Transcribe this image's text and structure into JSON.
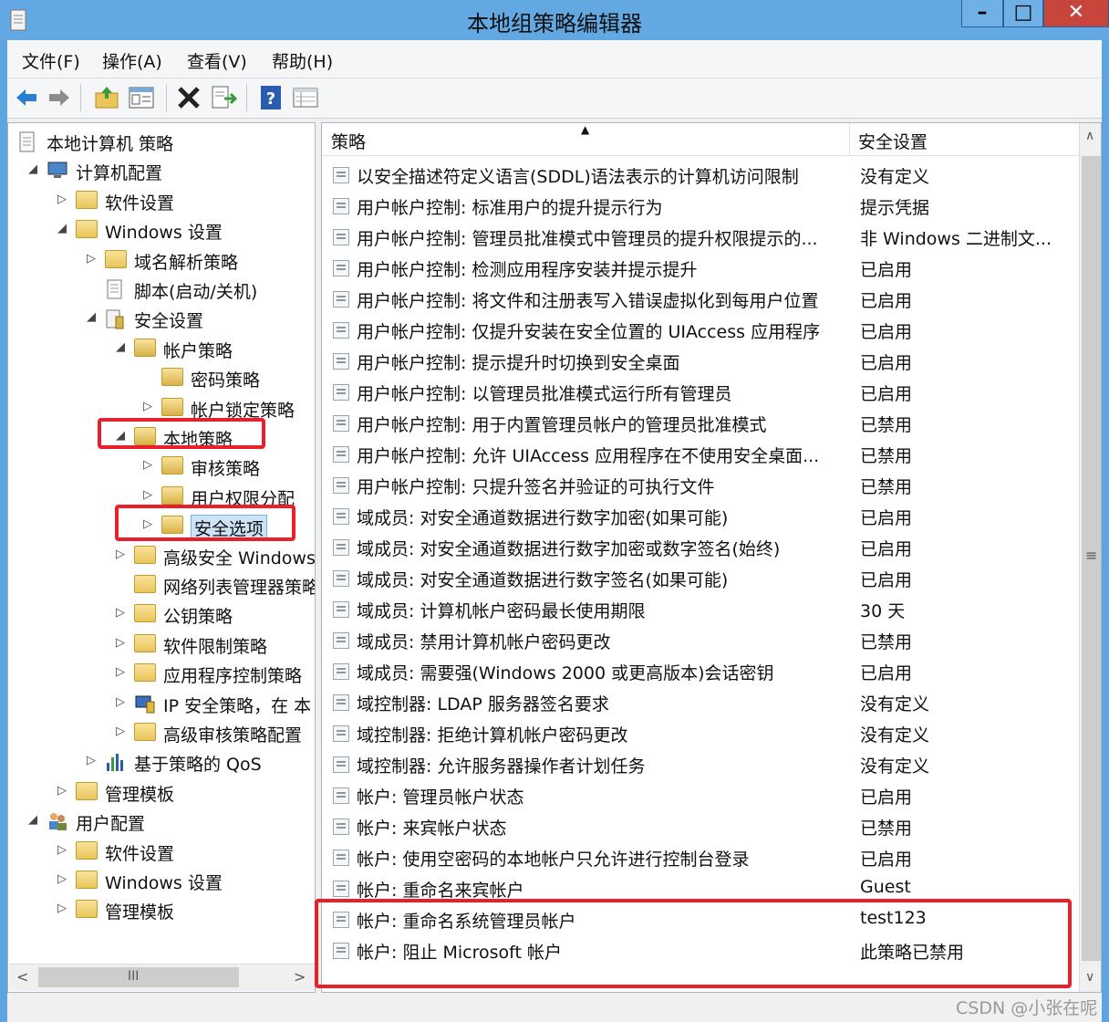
{
  "window": {
    "title": "本地组策略编辑器",
    "minimize": "–",
    "maximize": "□",
    "close": "✕"
  },
  "menu": [
    "文件(F)",
    "操作(A)",
    "查看(V)",
    "帮助(H)"
  ],
  "toolbar": {
    "icons": [
      "back-arrow-icon",
      "forward-arrow-icon",
      "up-folder-icon",
      "show-hide-tree-icon",
      "delete-icon",
      "export-list-icon",
      "help-icon",
      "view-icon"
    ]
  },
  "tree": {
    "nodes": [
      {
        "label": "本地计算机 策略",
        "expander": ""
      },
      {
        "label": "计算机配置",
        "expander": "◢"
      },
      {
        "label": "软件设置",
        "expander": "▷"
      },
      {
        "label": "Windows 设置",
        "expander": "◢"
      },
      {
        "label": "域名解析策略",
        "expander": "▷"
      },
      {
        "label": "脚本(启动/关机)",
        "expander": ""
      },
      {
        "label": "安全设置",
        "expander": "◢"
      },
      {
        "label": "帐户策略",
        "expander": "◢"
      },
      {
        "label": "密码策略",
        "expander": ""
      },
      {
        "label": "帐户锁定策略",
        "expander": "▷"
      },
      {
        "label": "本地策略",
        "expander": "◢"
      },
      {
        "label": "审核策略",
        "expander": "▷"
      },
      {
        "label": "用户权限分配",
        "expander": "▷"
      },
      {
        "label": "安全选项",
        "expander": "▷"
      },
      {
        "label": "高级安全 Windows",
        "expander": "▷"
      },
      {
        "label": "网络列表管理器策略",
        "expander": ""
      },
      {
        "label": "公钥策略",
        "expander": "▷"
      },
      {
        "label": "软件限制策略",
        "expander": "▷"
      },
      {
        "label": "应用程序控制策略",
        "expander": "▷"
      },
      {
        "label": "IP 安全策略，在 本",
        "expander": "▷"
      },
      {
        "label": "高级审核策略配置",
        "expander": "▷"
      },
      {
        "label": "基于策略的 QoS",
        "expander": "▷"
      },
      {
        "label": "管理模板",
        "expander": "▷"
      },
      {
        "label": "用户配置",
        "expander": "◢"
      },
      {
        "label": "软件设置",
        "expander": "▷"
      },
      {
        "label": "Windows 设置",
        "expander": "▷"
      },
      {
        "label": "管理模板",
        "expander": "▷"
      }
    ],
    "hscroll_grip": "III",
    "hscroll_left": "<",
    "hscroll_right": ">"
  },
  "list": {
    "columns": [
      "策略",
      "安全设置"
    ],
    "sort_indicator": "▲",
    "rows": [
      {
        "policy": "以安全描述符定义语言(SDDL)语法表示的计算机访问限制",
        "setting": "没有定义"
      },
      {
        "policy": "用户帐户控制: 标准用户的提升提示行为",
        "setting": "提示凭据"
      },
      {
        "policy": "用户帐户控制: 管理员批准模式中管理员的提升权限提示的...",
        "setting": "非 Windows 二进制文..."
      },
      {
        "policy": "用户帐户控制: 检测应用程序安装并提示提升",
        "setting": "已启用"
      },
      {
        "policy": "用户帐户控制: 将文件和注册表写入错误虚拟化到每用户位置",
        "setting": "已启用"
      },
      {
        "policy": "用户帐户控制: 仅提升安装在安全位置的 UIAccess 应用程序",
        "setting": "已启用"
      },
      {
        "policy": "用户帐户控制: 提示提升时切换到安全桌面",
        "setting": "已启用"
      },
      {
        "policy": "用户帐户控制: 以管理员批准模式运行所有管理员",
        "setting": "已启用"
      },
      {
        "policy": "用户帐户控制: 用于内置管理员帐户的管理员批准模式",
        "setting": "已禁用"
      },
      {
        "policy": "用户帐户控制: 允许 UIAccess 应用程序在不使用安全桌面...",
        "setting": "已禁用"
      },
      {
        "policy": "用户帐户控制: 只提升签名并验证的可执行文件",
        "setting": "已禁用"
      },
      {
        "policy": "域成员: 对安全通道数据进行数字加密(如果可能)",
        "setting": "已启用"
      },
      {
        "policy": "域成员: 对安全通道数据进行数字加密或数字签名(始终)",
        "setting": "已启用"
      },
      {
        "policy": "域成员: 对安全通道数据进行数字签名(如果可能)",
        "setting": "已启用"
      },
      {
        "policy": "域成员: 计算机帐户密码最长使用期限",
        "setting": "30 天"
      },
      {
        "policy": "域成员: 禁用计算机帐户密码更改",
        "setting": "已禁用"
      },
      {
        "policy": "域成员: 需要强(Windows 2000 或更高版本)会话密钥",
        "setting": "已启用"
      },
      {
        "policy": "域控制器: LDAP 服务器签名要求",
        "setting": "没有定义"
      },
      {
        "policy": "域控制器: 拒绝计算机帐户密码更改",
        "setting": "没有定义"
      },
      {
        "policy": "域控制器: 允许服务器操作者计划任务",
        "setting": "没有定义"
      },
      {
        "policy": "帐户: 管理员帐户状态",
        "setting": "已启用"
      },
      {
        "policy": "帐户: 来宾帐户状态",
        "setting": "已禁用"
      },
      {
        "policy": "帐户: 使用空密码的本地帐户只允许进行控制台登录",
        "setting": "已启用"
      },
      {
        "policy": "帐户: 重命名来宾帐户",
        "setting": "Guest"
      },
      {
        "policy": "帐户: 重命名系统管理员帐户",
        "setting": "test123"
      },
      {
        "policy": "帐户: 阻止 Microsoft 帐户",
        "setting": "此策略已禁用"
      }
    ],
    "vscroll_up": "∧",
    "vscroll_down": "∨",
    "vscroll_grip": "≡"
  },
  "watermark": "CSDN @小张在呢",
  "colors": {
    "title_bar": "#62a8e2",
    "close_button": "#c7453b",
    "highlight_box": "#e8202a",
    "selection": "#cde4f7"
  }
}
